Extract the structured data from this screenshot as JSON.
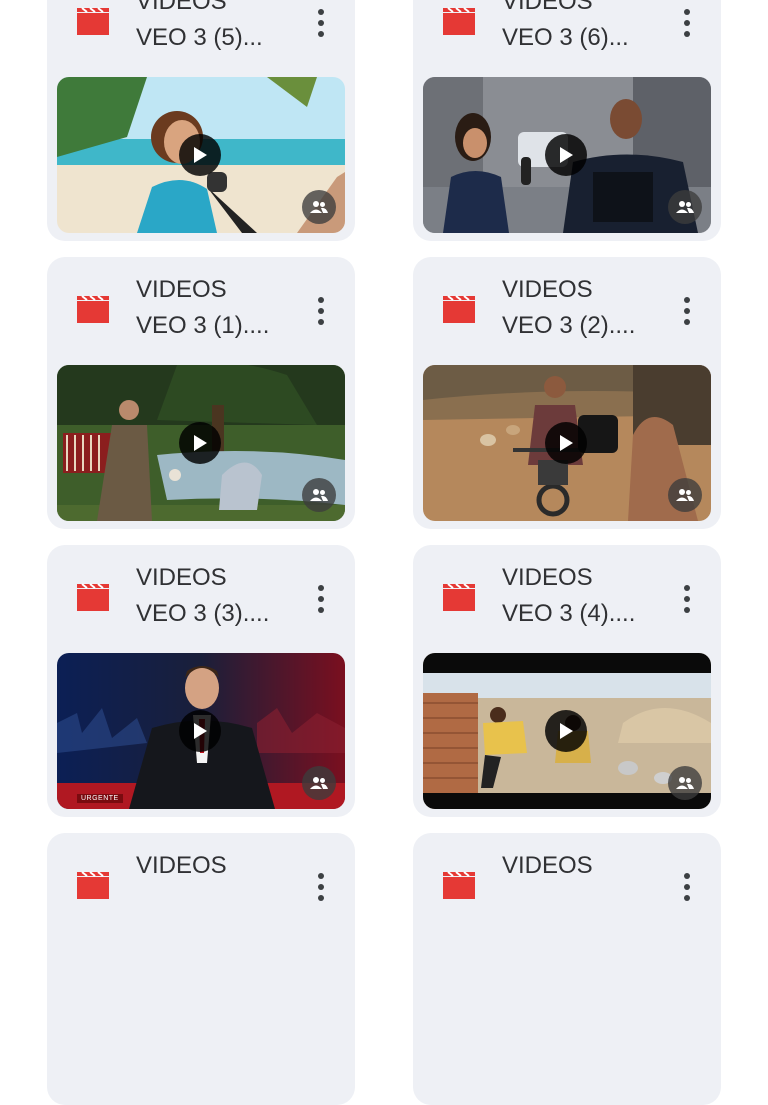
{
  "colors": {
    "accent_red": "#e53935",
    "card_bg": "#eef0f5",
    "text": "#303134"
  },
  "icons": {
    "file_type": "video-clapperboard-icon",
    "menu": "more-vert-icon",
    "play": "play-icon",
    "shared": "people-icon"
  },
  "files": [
    {
      "line1": "VIDEOS",
      "line2": "VEO 3  (5)..."
    },
    {
      "line1": "VIDEOS",
      "line2": "VEO 3  (6)..."
    },
    {
      "line1": "VIDEOS",
      "line2": "VEO 3 (1)...."
    },
    {
      "line1": "VIDEOS",
      "line2": "VEO 3 (2)...."
    },
    {
      "line1": "VIDEOS",
      "line2": "VEO 3 (3)...."
    },
    {
      "line1": "VIDEOS",
      "line2": "VEO 3 (4)...."
    },
    {
      "line1": "VIDEOS",
      "line2": ""
    },
    {
      "line1": "VIDEOS",
      "line2": ""
    }
  ],
  "thumbnail_overlay": {
    "urgent_label": "URGENTE"
  }
}
